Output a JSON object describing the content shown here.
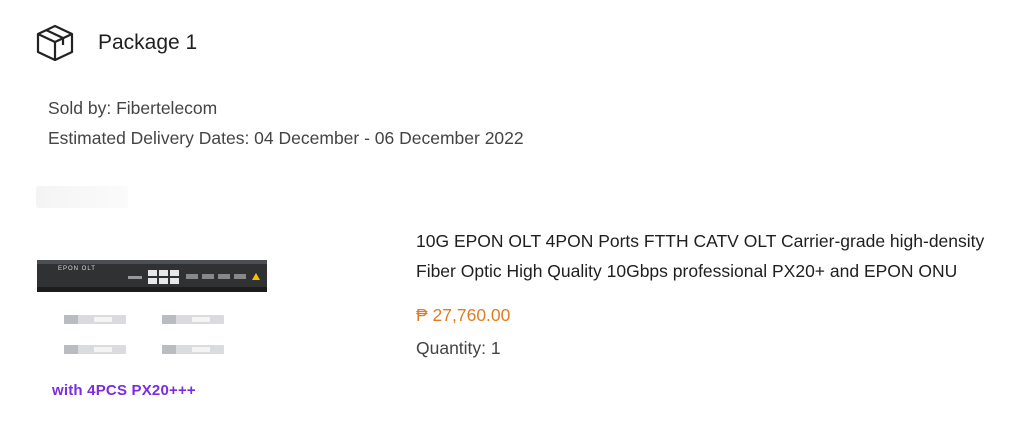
{
  "package": {
    "icon": "package-box-icon",
    "title": "Package 1"
  },
  "order": {
    "seller_text": "Sold by: Fibertelecom",
    "delivery_text": "Estimated Delivery Dates: 04 December - 06 December 2022"
  },
  "product": {
    "image_label": "EPON OLT",
    "image_caption": "with 4PCS PX20+++",
    "name": "10G EPON OLT 4PON Ports FTTH CATV OLT Carrier-grade high-density Fiber Optic High Quality 10Gbps professional PX20+ and EPON ONU",
    "price": "₱ 27,760.00",
    "quantity_text": "Quantity: 1",
    "price_color": "#e27c22",
    "caption_color": "#7b2be2"
  }
}
